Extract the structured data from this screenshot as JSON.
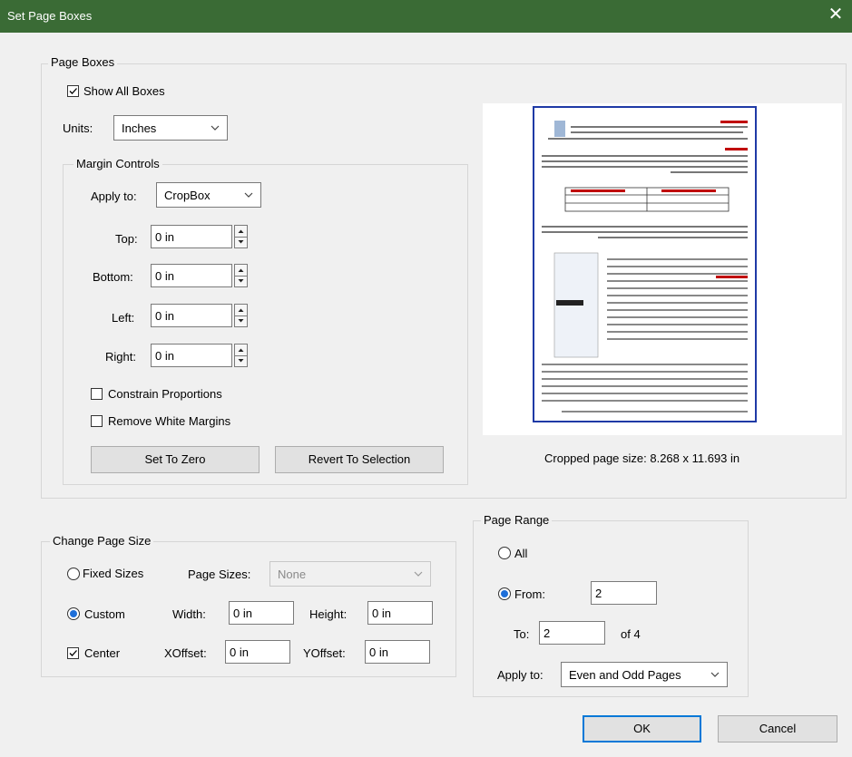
{
  "window": {
    "title": "Set Page Boxes",
    "close_glyph": "✕"
  },
  "page_boxes": {
    "legend": "Page Boxes",
    "show_all_boxes": {
      "label": "Show All Boxes",
      "checked": true
    },
    "units": {
      "label": "Units:",
      "value": "Inches"
    },
    "margin_controls": {
      "legend": "Margin Controls",
      "apply_to": {
        "label": "Apply to:",
        "value": "CropBox"
      },
      "top": {
        "label": "Top:",
        "value": "0 in"
      },
      "bottom": {
        "label": "Bottom:",
        "value": "0 in"
      },
      "left": {
        "label": "Left:",
        "value": "0 in"
      },
      "right": {
        "label": "Right:",
        "value": "0 in"
      },
      "constrain_proportions": {
        "label": "Constrain Proportions",
        "checked": false
      },
      "remove_white_margins": {
        "label": "Remove White Margins",
        "checked": false
      },
      "set_to_zero": "Set To Zero",
      "revert_to_selection": "Revert To Selection"
    },
    "cropped_size": "Cropped page size: 8.268 x 11.693 in"
  },
  "change_page_size": {
    "legend": "Change Page Size",
    "fixed_sizes": {
      "label": "Fixed Sizes",
      "selected": false
    },
    "page_sizes": {
      "label": "Page Sizes:",
      "value": "None"
    },
    "custom": {
      "label": "Custom",
      "selected": true
    },
    "width": {
      "label": "Width:",
      "value": "0 in"
    },
    "height": {
      "label": "Height:",
      "value": "0 in"
    },
    "center": {
      "label": "Center",
      "checked": true
    },
    "xoffset": {
      "label": "XOffset:",
      "value": "0 in"
    },
    "yoffset": {
      "label": "YOffset:",
      "value": "0 in"
    }
  },
  "page_range": {
    "legend": "Page Range",
    "all": {
      "label": "All",
      "selected": false
    },
    "from": {
      "label": "From:",
      "value": "2",
      "selected": true
    },
    "to": {
      "label": "To:",
      "value": "2"
    },
    "of_total": "of 4",
    "apply_to": {
      "label": "Apply to:",
      "value": "Even and Odd Pages"
    }
  },
  "footer": {
    "ok": "OK",
    "cancel": "Cancel"
  },
  "colors": {
    "titlebar": "#3a6b35",
    "accent": "#1e6fd9",
    "preview_border": "#1f3aa6"
  }
}
